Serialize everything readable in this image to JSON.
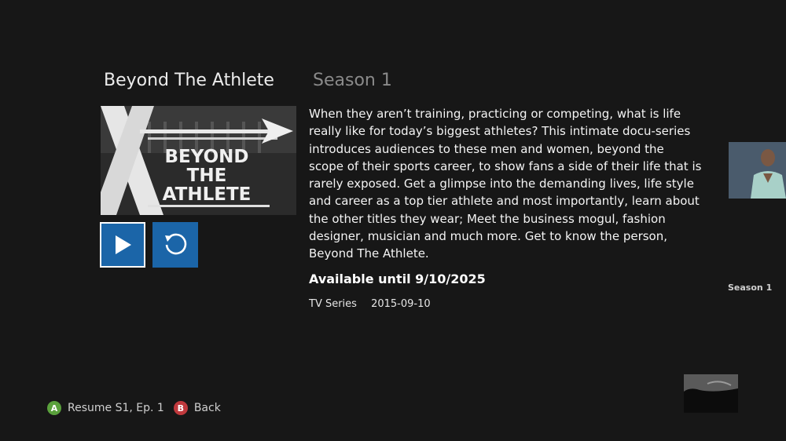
{
  "show": {
    "title": "Beyond The Athlete",
    "season_heading": "Season 1",
    "poster_text": [
      "BEYOND",
      "THE",
      "ATHLETE"
    ],
    "description": "When they aren’t training, practicing or competing, what is life really like for today’s biggest athletes? This intimate docu-series introduces audiences to these men and women, beyond the scope of their sports career, to show fans a side of their life that is rarely exposed. Get a glimpse into the demanding lives, life style and career as a top tier athlete and most importantly, learn about the other titles they wear; Meet the business mogul, fashion designer, musician and much more. Get to know the person, Beyond The Athlete.",
    "availability": "Available until 9/10/2025",
    "type": "TV Series",
    "date": "2015-09-10"
  },
  "actions": {
    "play_icon": "play-icon",
    "restart_icon": "restart-icon"
  },
  "side_panel": {
    "season_label": "Season 1"
  },
  "controller_hints": [
    {
      "button": "A",
      "label": "Resume S1, Ep. 1",
      "color": "#5aa13c"
    },
    {
      "button": "B",
      "label": "Back",
      "color": "#c0393d"
    }
  ],
  "colors": {
    "background": "#171717",
    "accent": "#1b65a8"
  }
}
